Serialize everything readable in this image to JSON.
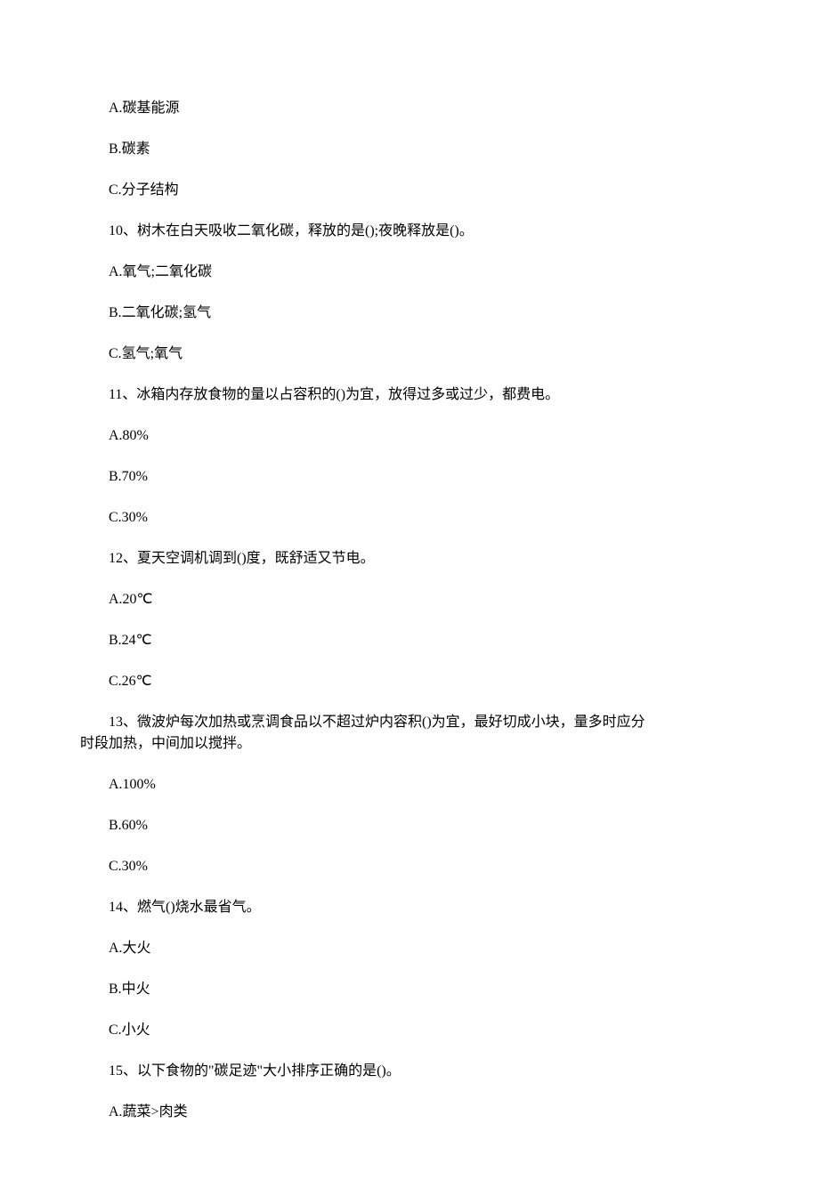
{
  "content": [
    {
      "type": "option",
      "text": "A.碳基能源"
    },
    {
      "type": "option",
      "text": "B.碳素"
    },
    {
      "type": "option",
      "text": "C.分子结构"
    },
    {
      "type": "question",
      "text": "10、树木在白天吸收二氧化碳，释放的是();夜晚释放是()。"
    },
    {
      "type": "option",
      "text": "A.氧气;二氧化碳"
    },
    {
      "type": "option",
      "text": "B.二氧化碳;氢气"
    },
    {
      "type": "option",
      "text": "C.氢气;氧气"
    },
    {
      "type": "question",
      "text": "11、冰箱内存放食物的量以占容积的()为宜，放得过多或过少，都费电。"
    },
    {
      "type": "option",
      "text": "A.80%"
    },
    {
      "type": "option",
      "text": "B.70%"
    },
    {
      "type": "option",
      "text": "C.30%"
    },
    {
      "type": "question",
      "text": "12、夏天空调机调到()度，既舒适又节电。"
    },
    {
      "type": "option",
      "text": "A.20℃"
    },
    {
      "type": "option",
      "text": "B.24℃"
    },
    {
      "type": "option",
      "text": "C.26℃"
    },
    {
      "type": "question-multi",
      "lines": [
        "13、微波炉每次加热或烹调食品以不超过炉内容积()为宜，最好切成小块，量多时应分",
        "时段加热，中间加以搅拌。"
      ]
    },
    {
      "type": "option",
      "text": "A.100%"
    },
    {
      "type": "option",
      "text": "B.60%"
    },
    {
      "type": "option",
      "text": "C.30%"
    },
    {
      "type": "question",
      "text": "14、燃气()烧水最省气。"
    },
    {
      "type": "option",
      "text": "A.大火"
    },
    {
      "type": "option",
      "text": "B.中火"
    },
    {
      "type": "option",
      "text": "C.小火"
    },
    {
      "type": "question",
      "text": "15、以下食物的\"碳足迹\"大小排序正确的是()。"
    },
    {
      "type": "option",
      "text": "A.蔬菜>肉类"
    }
  ]
}
